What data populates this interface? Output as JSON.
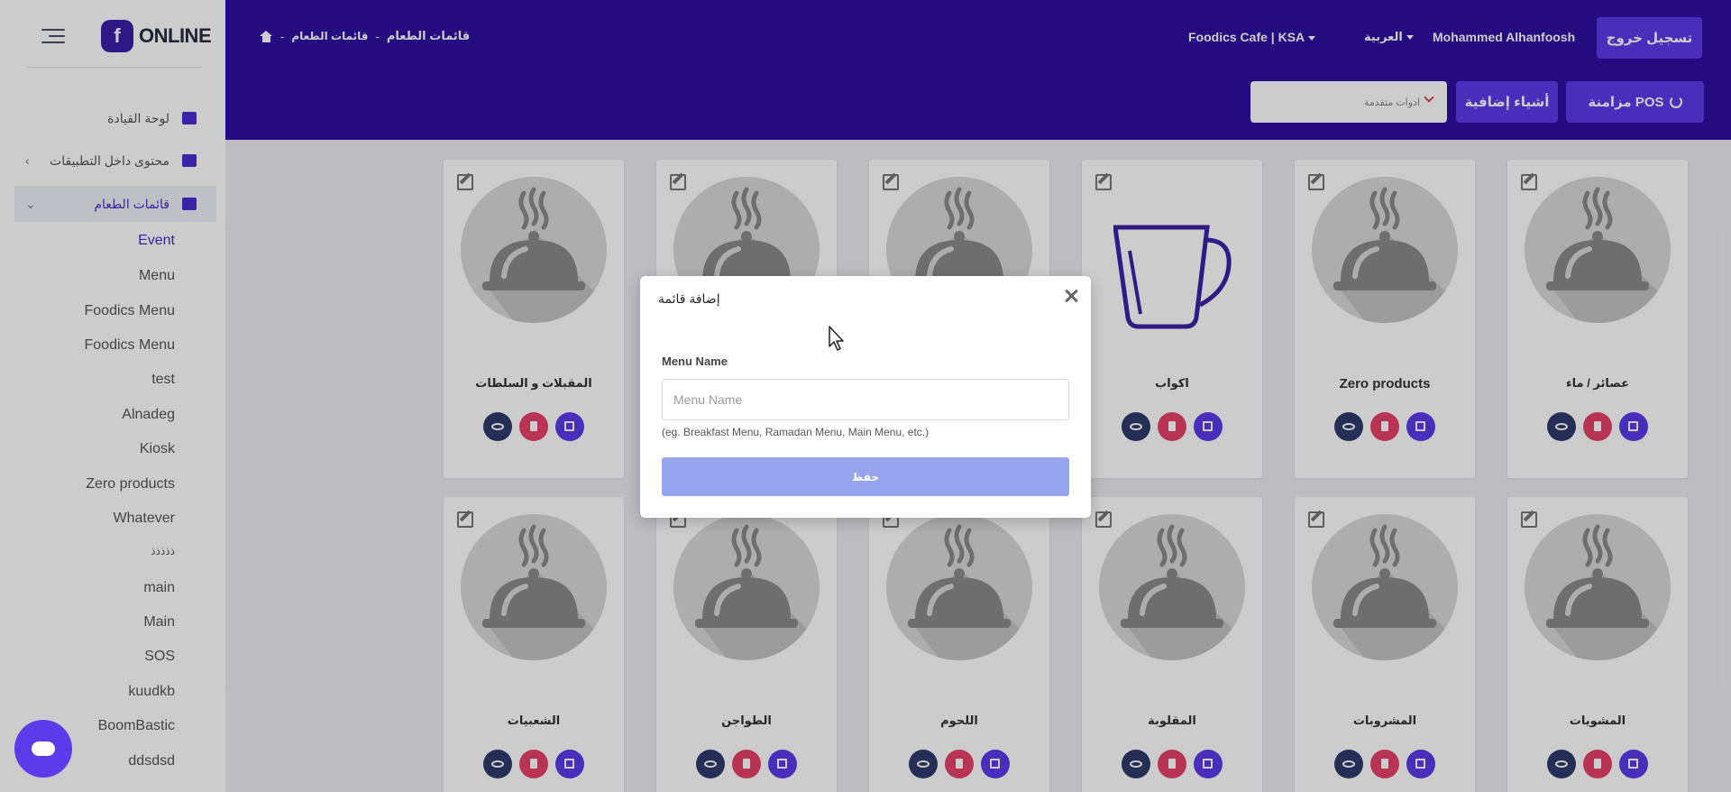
{
  "app": {
    "logo_letter": "f",
    "logo_text": "ONLINE"
  },
  "sidebar": {
    "nav": [
      {
        "label": "لوحة القيادة"
      },
      {
        "label": "محتوى داخل التطبيقات"
      },
      {
        "label": "قائمات الطعام"
      }
    ],
    "submenu": [
      "Event",
      "Menu",
      "Foodics Menu",
      "Foodics Menu",
      "test",
      "Alnadeg",
      "Kiosk",
      "Zero products",
      "Whatever",
      "ذذذذذ",
      "main",
      "Main",
      "SOS",
      "kuudkb",
      "BoomBastic",
      "ddsdsd"
    ]
  },
  "header": {
    "breadcrumb": {
      "parent": "قائمات الطعام",
      "sep": "-",
      "current": "قائمات الطعام"
    },
    "branch": "Foodics Cafe | KSA",
    "language": "العربية",
    "user": "Mohammed Alhanfoosh",
    "logout": "تسجيل خروج",
    "tools_placeholder": "ادوات متقدمة",
    "extras": "أشياء إضافية",
    "sync": "مزامنة POS"
  },
  "cards": [
    {
      "title": "المقبلات و السلطات",
      "icon": "cloche"
    },
    {
      "title": "",
      "icon": "cloche"
    },
    {
      "title": "",
      "icon": "cloche"
    },
    {
      "title": "اكواب",
      "icon": "cup"
    },
    {
      "title": "Zero products",
      "icon": "cloche"
    },
    {
      "title": "عصائر / ماء",
      "icon": "cloche"
    },
    {
      "title": "الشعبيات",
      "icon": "cloche"
    },
    {
      "title": "الطواجن",
      "icon": "cloche"
    },
    {
      "title": "اللحوم",
      "icon": "cloche"
    },
    {
      "title": "المقلوبة",
      "icon": "cloche"
    },
    {
      "title": "المشروبات",
      "icon": "cloche"
    },
    {
      "title": "المشويات",
      "icon": "cloche"
    }
  ],
  "modal": {
    "title": "إضافة قائمة",
    "field_label": "Menu Name",
    "field_placeholder": "Menu Name",
    "field_value": "",
    "hint": "(eg. Breakfast Menu, Ramadan Menu, Main Menu, etc.)",
    "save_label": "حفظ"
  },
  "colors": {
    "brand": "#2e0fa0",
    "accent": "#5b3bea",
    "danger": "#e5416b",
    "save_disabled": "#97a5ee"
  }
}
